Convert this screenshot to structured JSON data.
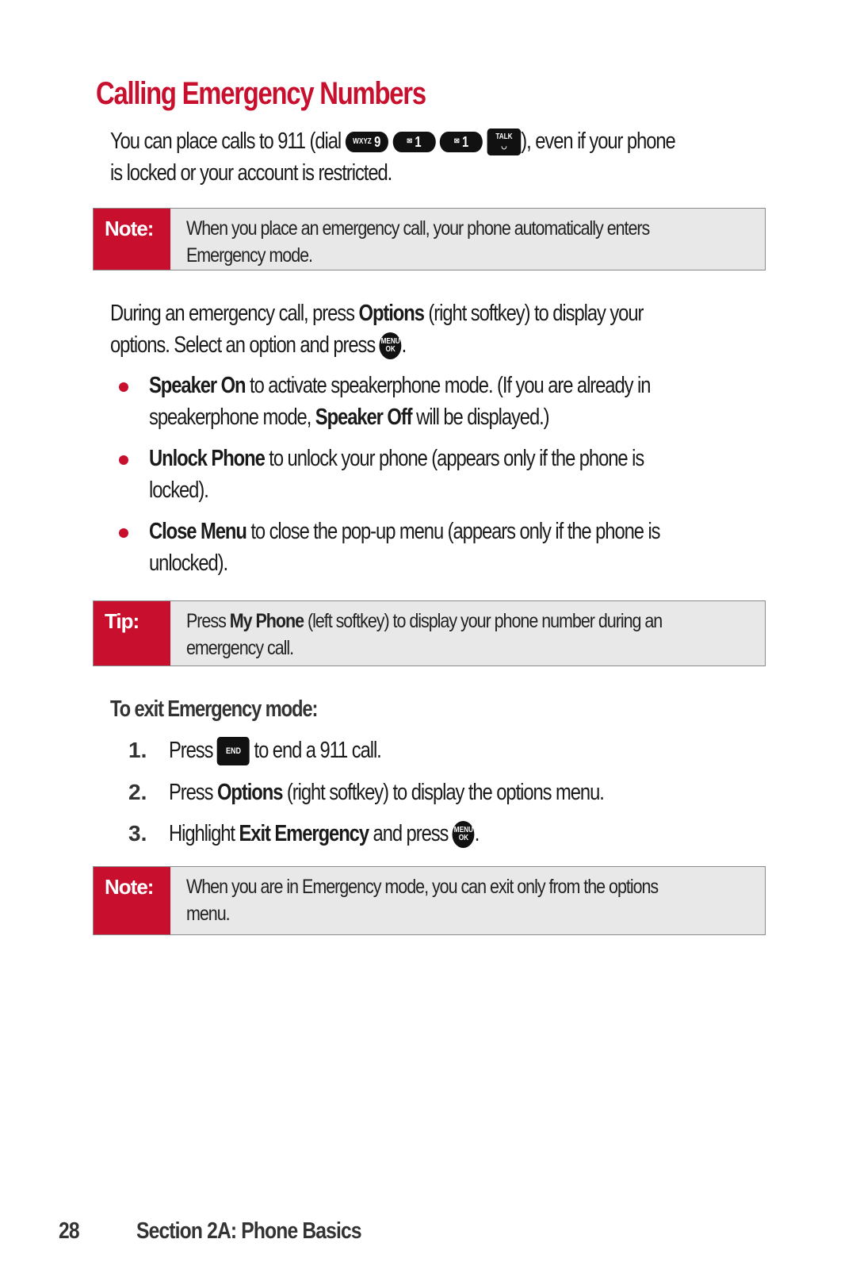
{
  "title": "Calling Emergency Numbers",
  "intro": {
    "text_before": "You can place calls to 911 (dial",
    "keys": [
      {
        "icon": "key-9-wxyz",
        "small": "WXYZ",
        "main": "9"
      },
      {
        "icon": "key-1-mail",
        "small": "✉",
        "main": "1"
      },
      {
        "icon": "key-1-mail",
        "small": "✉",
        "main": "1"
      },
      {
        "icon": "talk-key",
        "label": "TALK"
      }
    ],
    "text_after": "), even if your phone",
    "line2": "is locked or your account is restricted."
  },
  "note1": {
    "label": "Note:",
    "line1": "When you place an emergency call, your phone automatically enters",
    "line2": "Emergency mode."
  },
  "para2": {
    "a": "During an emergency call, press ",
    "b": "Options",
    "c": " (right softkey) to display your",
    "line2": "options. Select an option and press ",
    "end": "."
  },
  "menu_ok_key": {
    "top": "MENU",
    "bottom": "OK"
  },
  "bullets": [
    {
      "bold": "Speaker On",
      "text": " to activate speakerphone mode. (If you are already in",
      "line2a": "speakerphone mode, ",
      "line2b": "Speaker Off",
      "line2c": " will be displayed.)"
    },
    {
      "bold": "Unlock Phone",
      "text": " to unlock your phone (appears only if the phone is",
      "line2": "locked)."
    },
    {
      "bold": "Close Menu",
      "text": " to close the pop-up menu (appears only if the phone is",
      "line2": "unlocked)."
    }
  ],
  "tip": {
    "label": "Tip:",
    "a": "Press ",
    "b": "My Phone",
    "c": " (left softkey) to display your phone number during an",
    "line2": "emergency call."
  },
  "exit_heading": "To exit Emergency mode:",
  "steps": [
    {
      "num": "1.",
      "a": "Press ",
      "key": "END",
      "c": " to end a 911 call."
    },
    {
      "num": "2.",
      "a": "Press ",
      "b": "Options",
      "c": " (right softkey) to display the options menu."
    },
    {
      "num": "3.",
      "a": "Highlight ",
      "b": "Exit Emergency",
      "c": " and press ",
      "end": "."
    }
  ],
  "note2": {
    "label": "Note:",
    "line1": "When you are in Emergency mode, you can exit only from the options",
    "line2": "menu."
  },
  "footer": {
    "page": "28",
    "section": "Section 2A: Phone Basics"
  },
  "colors": {
    "accent": "#c8102e",
    "box_bg": "#e8e8e8"
  }
}
